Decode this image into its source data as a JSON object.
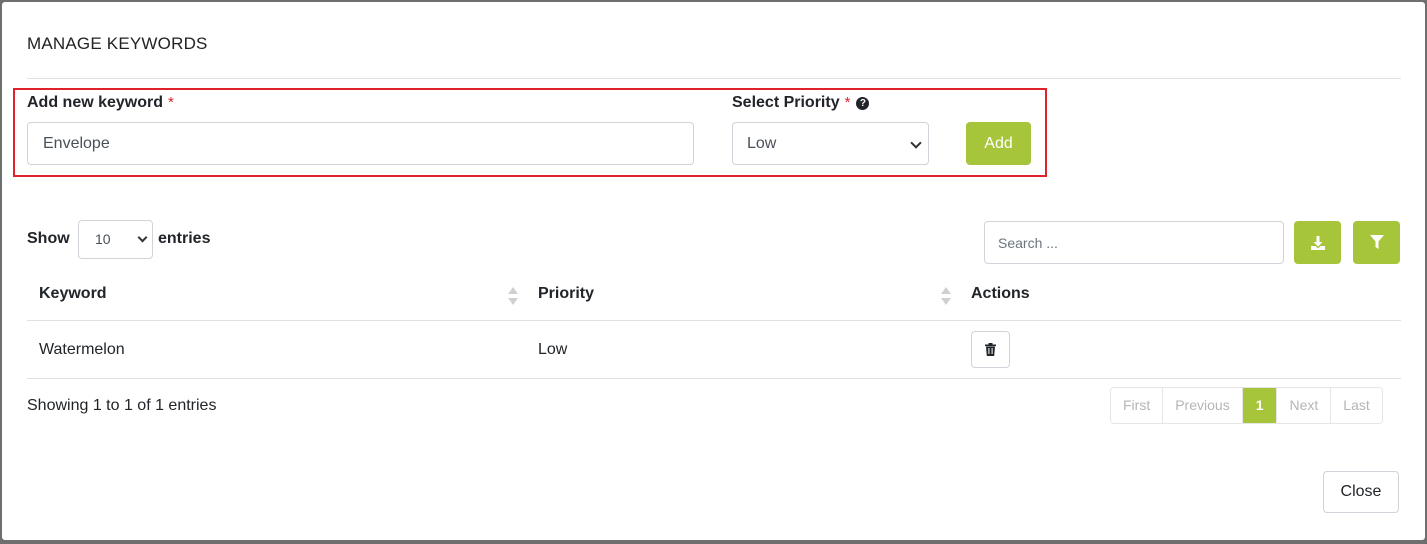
{
  "modal": {
    "title": "MANAGE KEYWORDS",
    "close_label": "Close"
  },
  "form": {
    "keyword_label": "Add new keyword",
    "keyword_required": "*",
    "keyword_value": "Envelope",
    "priority_label": "Select Priority",
    "priority_required": "*",
    "priority_value": "Low",
    "add_label": "Add"
  },
  "table_controls": {
    "show_label": "Show",
    "entries_label": "entries",
    "page_length": "10",
    "search_placeholder": "Search ...",
    "download_icon": "download-icon",
    "filter_icon": "filter-icon"
  },
  "table": {
    "columns": [
      "Keyword",
      "Priority",
      "Actions"
    ],
    "rows": [
      {
        "keyword": "Watermelon",
        "priority": "Low"
      }
    ]
  },
  "footer": {
    "info": "Showing 1 to 1 of 1 entries",
    "pagination": {
      "first": "First",
      "previous": "Previous",
      "current": "1",
      "next": "Next",
      "last": "Last"
    }
  },
  "colors": {
    "accent": "#a6c53a",
    "required": "#e0232b",
    "highlight": "#e0232b"
  }
}
